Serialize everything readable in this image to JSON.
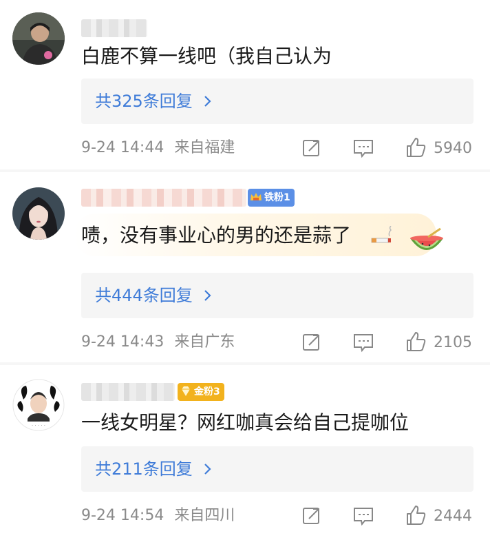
{
  "comments": [
    {
      "text": "白鹿不算一线吧（我自己认为",
      "replies": "共325条回复",
      "time": "9-24 14:44",
      "location": "来自福建",
      "likes": "5940"
    },
    {
      "text": "啧，没有事业心的男的还是蒜了",
      "badge": "铁粉1",
      "replies": "共444条回复",
      "time": "9-24 14:43",
      "location": "来自广东",
      "likes": "2105",
      "emojis": [
        "cigarette-emoji",
        "watermelon-emoji"
      ]
    },
    {
      "text": "一线女明星？网红咖真会给自己提咖位",
      "badge": "金粉3",
      "replies": "共211条回复",
      "time": "9-24 14:54",
      "location": "来自四川",
      "likes": "2444"
    }
  ],
  "colors": {
    "link": "#3e7bd8",
    "meta": "#8a8a8a",
    "iron_badge": "#5b8fe6",
    "gold_badge": "#f2b21d"
  },
  "icons": [
    "forward-icon",
    "comment-icon",
    "like-icon",
    "chevron-right-icon"
  ]
}
